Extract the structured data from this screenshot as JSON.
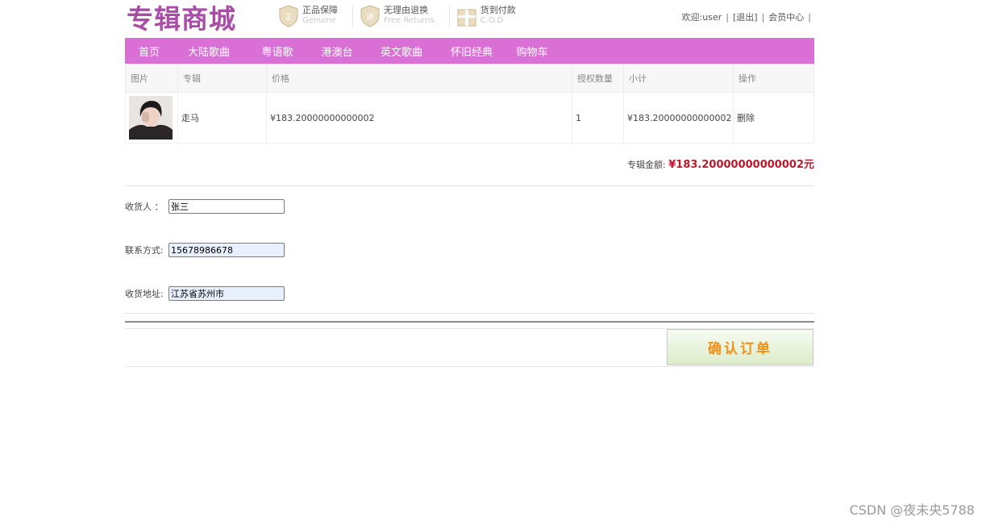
{
  "header": {
    "logo": "专辑商城",
    "badges": [
      {
        "title": "正品保障",
        "sub": "Genuine",
        "icon": "shield-zheng-icon"
      },
      {
        "title": "无理由退换",
        "sub": "Free Returns",
        "icon": "shield-tui-icon"
      },
      {
        "title": "货到付款",
        "sub": "C.O.D",
        "icon": "gift-box-icon"
      }
    ],
    "welcome": "欢迎:user",
    "logout": "[退出]",
    "member": "会员中心"
  },
  "nav": [
    "首页",
    "大陆歌曲",
    "粤语歌",
    "港澳台",
    "英文歌曲",
    "怀旧经典",
    "购物车"
  ],
  "cart": {
    "headers": [
      "图片",
      "专辑",
      "价格",
      "授权数量",
      "小计",
      "操作"
    ],
    "rows": [
      {
        "album": "走马",
        "price": "¥183.20000000000002",
        "qty": "1",
        "subtotal": "¥183.20000000000002",
        "action": "删除"
      }
    ],
    "total_label": "专辑金额:",
    "total_value": "¥183.20000000000002元"
  },
  "form": {
    "receiver_label": "收货人  ：",
    "receiver_value": "张三",
    "phone_label": "联系方式:",
    "phone_value": "15678986678",
    "address_label": "收货地址:",
    "address_value": "江苏省苏州市"
  },
  "confirm_label": "确认订单",
  "watermark": "CSDN @夜未央5788",
  "colors": {
    "nav_bg": "#da70d6",
    "logo": "#a94ea6",
    "total": "#c0182a",
    "confirm_text": "#f0901a"
  }
}
